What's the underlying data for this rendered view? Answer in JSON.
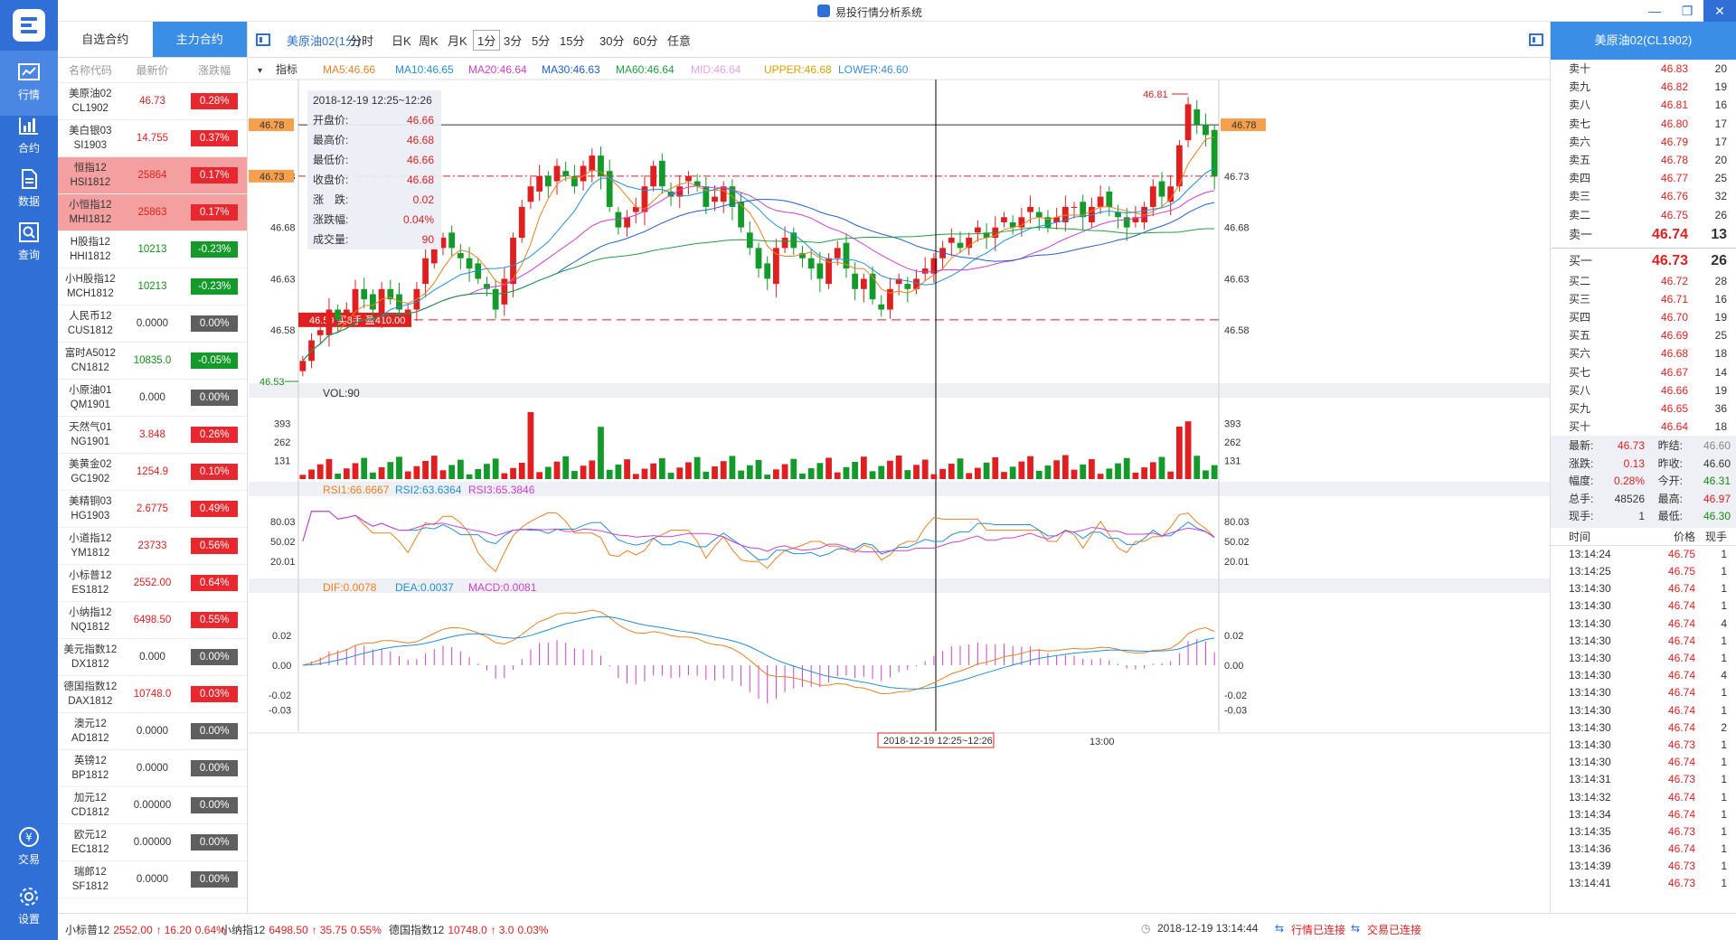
{
  "app": {
    "title": "易投行情分析系统"
  },
  "nav": {
    "items": [
      {
        "label": "行情"
      },
      {
        "label": "合约"
      },
      {
        "label": "数据"
      },
      {
        "label": "查询"
      },
      {
        "label": "交易"
      },
      {
        "label": "设置"
      }
    ]
  },
  "list": {
    "tabs": [
      "自选合约",
      "主力合约"
    ],
    "headers": [
      "名称代码",
      "最新价",
      "涨跌幅"
    ],
    "rows": [
      {
        "name": "美原油02",
        "code": "CL1902",
        "price": "46.73",
        "change": "0.28%",
        "dir": "up",
        "highlight": false
      },
      {
        "name": "美白银03",
        "code": "SI1903",
        "price": "14.755",
        "change": "0.37%",
        "dir": "up",
        "highlight": false
      },
      {
        "name": "恒指12",
        "code": "HSI1812",
        "price": "25864",
        "change": "0.17%",
        "dir": "up",
        "highlight": true
      },
      {
        "name": "小恒指12",
        "code": "MHI1812",
        "price": "25863",
        "change": "0.17%",
        "dir": "up",
        "highlight": true
      },
      {
        "name": "H股指12",
        "code": "HHI1812",
        "price": "10213",
        "change": "-0.23%",
        "dir": "down",
        "highlight": false
      },
      {
        "name": "小H股指12",
        "code": "MCH1812",
        "price": "10213",
        "change": "-0.23%",
        "dir": "down",
        "highlight": false
      },
      {
        "name": "人民币12",
        "code": "CUS1812",
        "price": "0.0000",
        "change": "0.00%",
        "dir": "flat",
        "highlight": false
      },
      {
        "name": "富时A5012",
        "code": "CN1812",
        "price": "10835.0",
        "change": "-0.05%",
        "dir": "down",
        "highlight": false
      },
      {
        "name": "小原油01",
        "code": "QM1901",
        "price": "0.000",
        "change": "0.00%",
        "dir": "flat",
        "highlight": false
      },
      {
        "name": "天然气01",
        "code": "NG1901",
        "price": "3.848",
        "change": "0.26%",
        "dir": "up",
        "highlight": false
      },
      {
        "name": "美黄金02",
        "code": "GC1902",
        "price": "1254.9",
        "change": "0.10%",
        "dir": "up",
        "highlight": false
      },
      {
        "name": "美精铜03",
        "code": "HG1903",
        "price": "2.6775",
        "change": "0.49%",
        "dir": "up",
        "highlight": false
      },
      {
        "name": "小道指12",
        "code": "YM1812",
        "price": "23733",
        "change": "0.56%",
        "dir": "up",
        "highlight": false
      },
      {
        "name": "小标普12",
        "code": "ES1812",
        "price": "2552.00",
        "change": "0.64%",
        "dir": "up",
        "highlight": false
      },
      {
        "name": "小纳指12",
        "code": "NQ1812",
        "price": "6498.50",
        "change": "0.55%",
        "dir": "up",
        "highlight": false
      },
      {
        "name": "美元指数12",
        "code": "DX1812",
        "price": "0.000",
        "change": "0.00%",
        "dir": "flat",
        "highlight": false
      },
      {
        "name": "德国指数12",
        "code": "DAX1812",
        "price": "10748.0",
        "change": "0.03%",
        "dir": "up",
        "highlight": false
      },
      {
        "name": "澳元12",
        "code": "AD1812",
        "price": "0.0000",
        "change": "0.00%",
        "dir": "flat",
        "highlight": false
      },
      {
        "name": "英镑12",
        "code": "BP1812",
        "price": "0.0000",
        "change": "0.00%",
        "dir": "flat",
        "highlight": false
      },
      {
        "name": "加元12",
        "code": "CD1812",
        "price": "0.00000",
        "change": "0.00%",
        "dir": "flat",
        "highlight": false
      },
      {
        "name": "欧元12",
        "code": "EC1812",
        "price": "0.00000",
        "change": "0.00%",
        "dir": "flat",
        "highlight": false
      },
      {
        "name": "瑞郎12",
        "code": "SF1812",
        "price": "0.0000",
        "change": "0.00%",
        "dir": "flat",
        "highlight": false
      }
    ]
  },
  "periods": {
    "contract": "美原油02(1分)",
    "items": [
      "分时",
      "日K",
      "周K",
      "月K",
      "1分",
      "3分",
      "5分",
      "15分",
      "30分",
      "60分",
      "任意"
    ],
    "selected": "1分"
  },
  "indicators": {
    "label": "指标",
    "ma": [
      {
        "text": "MA5:46.66",
        "color": "#f08020"
      },
      {
        "text": "MA10:46.65",
        "color": "#2090e0"
      },
      {
        "text": "MA20:46.64",
        "color": "#d040d0"
      },
      {
        "text": "MA30:46.63",
        "color": "#2060d0"
      },
      {
        "text": "MA60:46.64",
        "color": "#20a040"
      },
      {
        "text": "MID:46.64",
        "color": "#f0a0e0"
      },
      {
        "text": "UPPER:46.68",
        "color": "#e0a000"
      },
      {
        "text": "LOWER:46.60",
        "color": "#3a8ee6"
      }
    ],
    "vol": "VOL:90",
    "rsi": [
      {
        "text": "RSI1:66.6667",
        "color": "#f08020"
      },
      {
        "text": "RSI2:63.6364",
        "color": "#2090e0"
      },
      {
        "text": "RSI3:65.3846",
        "color": "#d040d0"
      }
    ],
    "macd": [
      {
        "text": "DIF:0.0078",
        "color": "#f08020"
      },
      {
        "text": "DEA:0.0037",
        "color": "#2090e0"
      },
      {
        "text": "MACD:0.0081",
        "color": "#d040d0"
      }
    ]
  },
  "infobox": {
    "time": "2018-12-19 12:25~12:26",
    "rows": [
      {
        "label": "开盘价:",
        "value": "46.66"
      },
      {
        "label": "最高价:",
        "value": "46.68"
      },
      {
        "label": "最低价:",
        "value": "46.66"
      },
      {
        "label": "收盘价:",
        "value": "46.68"
      },
      {
        "label": "涨　跌:",
        "value": "0.02"
      },
      {
        "label": "涨跌幅:",
        "value": "0.04%"
      },
      {
        "label": "成交量:",
        "value": "90"
      }
    ]
  },
  "priceaxis": {
    "left_tag_top": "46.78",
    "left_tag_mid": "46.73",
    "right_tag_top": "46.78",
    "ticks_left": [
      "46.73",
      "46.68",
      "46.63",
      "46.58"
    ],
    "ticks_right": [
      "46.78",
      "46.73",
      "46.68",
      "46.63",
      "46.58"
    ],
    "high_mark": "46.81",
    "low_mark": "46.53",
    "trade_tag": "46.59 买3手 盈410.00"
  },
  "volaxis": [
    "393",
    "262",
    "131"
  ],
  "rsiaxis": [
    "80.03",
    "50.02",
    "20.01"
  ],
  "macdaxis_left": [
    "0.02",
    "0.00",
    "-0.02",
    "-0.03"
  ],
  "macdaxis_right": [
    "0.02",
    "0.00",
    "-0.02",
    "-0.03"
  ],
  "timeaxis": {
    "cursor": "2018-12-19 12:25~12:26",
    "tick": "13:00"
  },
  "chart_data": {
    "type": "candlestick",
    "title": "美原油02(1分)",
    "ylim": [
      46.53,
      46.81
    ],
    "candles_close": [
      46.55,
      46.57,
      46.58,
      46.6,
      46.59,
      46.6,
      46.62,
      46.61,
      46.6,
      46.62,
      46.61,
      46.6,
      46.6,
      46.62,
      46.65,
      46.66,
      46.67,
      46.66,
      46.65,
      46.64,
      46.63,
      46.62,
      46.6,
      46.63,
      46.67,
      46.7,
      46.72,
      46.73,
      46.72,
      46.74,
      46.73,
      46.72,
      46.74,
      46.75,
      46.73,
      46.7,
      46.68,
      46.69,
      46.7,
      46.72,
      46.74,
      46.72,
      46.71,
      46.72,
      46.73,
      46.72,
      46.7,
      46.71,
      46.72,
      46.7,
      46.68,
      46.66,
      46.64,
      46.63,
      46.66,
      46.67,
      46.66,
      46.65,
      46.64,
      46.63,
      46.65,
      46.66,
      46.64,
      46.62,
      46.63,
      46.61,
      46.6,
      46.62,
      46.63,
      46.62,
      46.63,
      46.64,
      46.65,
      46.66,
      46.67,
      46.66,
      46.67,
      46.68,
      46.67,
      46.68,
      46.69,
      46.68,
      46.69,
      46.7,
      46.69,
      46.68,
      46.69,
      46.7,
      46.7,
      46.69,
      46.7,
      46.71,
      46.7,
      46.69,
      46.68,
      46.69,
      46.7,
      46.72,
      46.71,
      46.72,
      46.76,
      46.8,
      46.78,
      46.77,
      46.73
    ],
    "volume_axis": [
      131,
      262,
      393
    ],
    "rsi_axis": [
      20.01,
      50.02,
      80.03
    ],
    "macd_axis": [
      -0.03,
      -0.02,
      0.0,
      0.02
    ]
  },
  "book": {
    "header": "美原油02(CL1902)",
    "asks": [
      {
        "label": "卖十",
        "price": "46.83",
        "vol": "20"
      },
      {
        "label": "卖九",
        "price": "46.82",
        "vol": "19"
      },
      {
        "label": "卖八",
        "price": "46.81",
        "vol": "16"
      },
      {
        "label": "卖七",
        "price": "46.80",
        "vol": "17"
      },
      {
        "label": "卖六",
        "price": "46.79",
        "vol": "17"
      },
      {
        "label": "卖五",
        "price": "46.78",
        "vol": "20"
      },
      {
        "label": "卖四",
        "price": "46.77",
        "vol": "25"
      },
      {
        "label": "卖三",
        "price": "46.76",
        "vol": "32"
      },
      {
        "label": "卖二",
        "price": "46.75",
        "vol": "26"
      },
      {
        "label": "卖一",
        "price": "46.74",
        "vol": "13"
      }
    ],
    "bids": [
      {
        "label": "买一",
        "price": "46.73",
        "vol": "26"
      },
      {
        "label": "买二",
        "price": "46.72",
        "vol": "28"
      },
      {
        "label": "买三",
        "price": "46.71",
        "vol": "16"
      },
      {
        "label": "买四",
        "price": "46.70",
        "vol": "19"
      },
      {
        "label": "买五",
        "price": "46.69",
        "vol": "25"
      },
      {
        "label": "买六",
        "price": "46.68",
        "vol": "18"
      },
      {
        "label": "买七",
        "price": "46.67",
        "vol": "14"
      },
      {
        "label": "买八",
        "price": "46.66",
        "vol": "19"
      },
      {
        "label": "买九",
        "price": "46.65",
        "vol": "36"
      },
      {
        "label": "买十",
        "price": "46.64",
        "vol": "18"
      }
    ],
    "stats": [
      {
        "l1": "最新:",
        "v1": "46.73",
        "c1": "red",
        "l2": "昨结:",
        "v2": "46.60",
        "c2": "gray"
      },
      {
        "l1": "涨跌:",
        "v1": "0.13",
        "c1": "red",
        "l2": "昨收:",
        "v2": "46.60",
        "c2": "dark"
      },
      {
        "l1": "幅度:",
        "v1": "0.28%",
        "c1": "red",
        "l2": "今开:",
        "v2": "46.31",
        "c2": "green"
      },
      {
        "l1": "总手:",
        "v1": "48526",
        "c1": "dark",
        "l2": "最高:",
        "v2": "46.97",
        "c2": "red"
      },
      {
        "l1": "现手:",
        "v1": "1",
        "c1": "dark",
        "l2": "最低:",
        "v2": "46.30",
        "c2": "green"
      }
    ],
    "trade_headers": [
      "时间",
      "价格",
      "现手"
    ],
    "trades": [
      {
        "t": "13:14:24",
        "p": "46.75",
        "v": "1"
      },
      {
        "t": "13:14:25",
        "p": "46.75",
        "v": "1"
      },
      {
        "t": "13:14:30",
        "p": "46.74",
        "v": "1"
      },
      {
        "t": "13:14:30",
        "p": "46.74",
        "v": "1"
      },
      {
        "t": "13:14:30",
        "p": "46.74",
        "v": "4"
      },
      {
        "t": "13:14:30",
        "p": "46.74",
        "v": "1"
      },
      {
        "t": "13:14:30",
        "p": "46.74",
        "v": "1"
      },
      {
        "t": "13:14:30",
        "p": "46.74",
        "v": "4"
      },
      {
        "t": "13:14:30",
        "p": "46.74",
        "v": "1"
      },
      {
        "t": "13:14:30",
        "p": "46.74",
        "v": "1"
      },
      {
        "t": "13:14:30",
        "p": "46.74",
        "v": "2"
      },
      {
        "t": "13:14:30",
        "p": "46.73",
        "v": "1"
      },
      {
        "t": "13:14:30",
        "p": "46.74",
        "v": "1"
      },
      {
        "t": "13:14:31",
        "p": "46.73",
        "v": "1"
      },
      {
        "t": "13:14:32",
        "p": "46.74",
        "v": "1"
      },
      {
        "t": "13:14:34",
        "p": "46.74",
        "v": "1"
      },
      {
        "t": "13:14:35",
        "p": "46.73",
        "v": "1"
      },
      {
        "t": "13:14:36",
        "p": "46.74",
        "v": "1"
      },
      {
        "t": "13:14:39",
        "p": "46.73",
        "v": "1"
      },
      {
        "t": "13:14:41",
        "p": "46.73",
        "v": "1"
      }
    ]
  },
  "status": {
    "ticker": [
      {
        "name": "小标普12",
        "price": "2552.00",
        "chg": "16.20",
        "pct": "0.64%"
      },
      {
        "name": "小纳指12",
        "price": "6498.50",
        "chg": "35.75",
        "pct": "0.55%"
      },
      {
        "name": "德国指数12",
        "price": "10748.0",
        "chg": "3.0",
        "pct": "0.03%"
      }
    ],
    "datetime": "2018-12-19 13:14:44",
    "quote_status": "行情已连接",
    "trade_status": "交易已连接"
  }
}
